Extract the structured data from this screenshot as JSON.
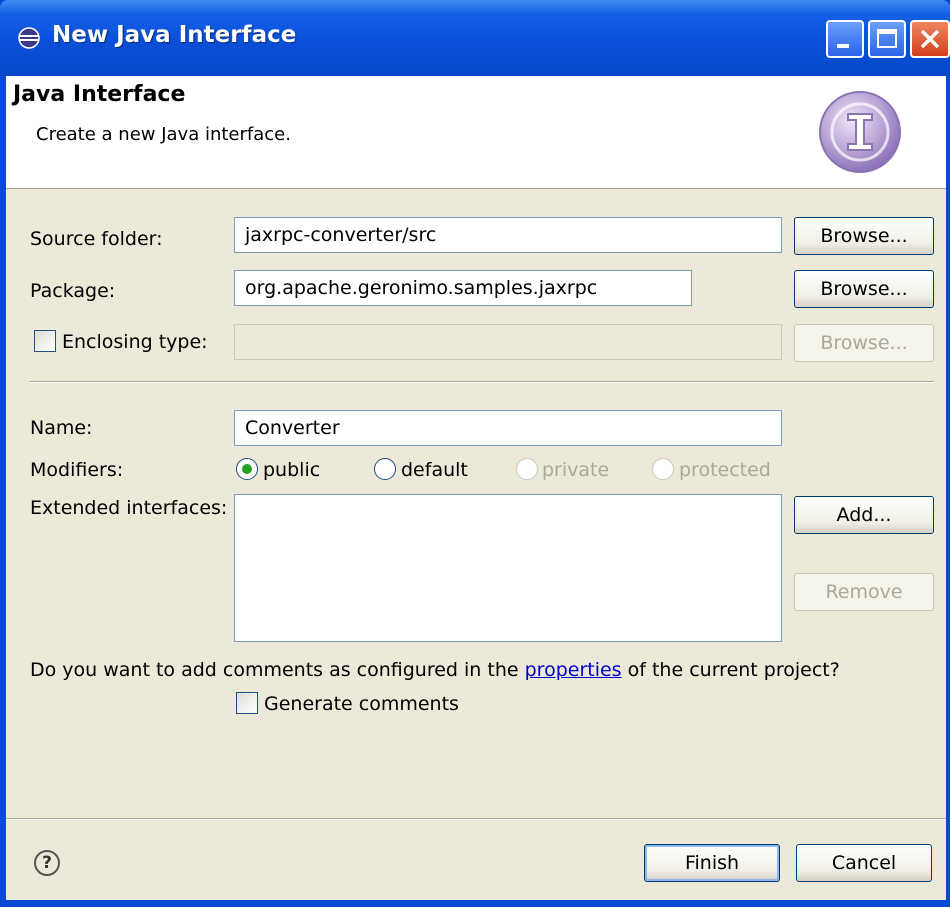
{
  "window": {
    "title": "New Java Interface"
  },
  "header": {
    "title": "Java Interface",
    "description": "Create a new Java interface."
  },
  "form": {
    "source_folder": {
      "label": "Source folder:",
      "value": "jaxrpc-converter/src",
      "browse": "Browse..."
    },
    "package": {
      "label": "Package:",
      "value": "org.apache.geronimo.samples.jaxrpc",
      "browse": "Browse..."
    },
    "enclosing_type": {
      "label": "Enclosing type:",
      "value": "",
      "browse": "Browse...",
      "checked": false
    },
    "name": {
      "label": "Name:",
      "value": "Converter"
    },
    "modifiers": {
      "label": "Modifiers:",
      "options": [
        {
          "label": "public",
          "selected": true,
          "enabled": true
        },
        {
          "label": "default",
          "selected": false,
          "enabled": true
        },
        {
          "label": "private",
          "selected": false,
          "enabled": false
        },
        {
          "label": "protected",
          "selected": false,
          "enabled": false
        }
      ]
    },
    "extended_interfaces": {
      "label": "Extended interfaces:",
      "add": "Add...",
      "remove": "Remove"
    },
    "comments": {
      "question_prefix": "Do you want to add comments as configured in the ",
      "question_link": "properties",
      "question_suffix": " of the current project?",
      "generate_label": "Generate comments",
      "checked": false
    }
  },
  "footer": {
    "help_icon": "help-icon",
    "finish": "Finish",
    "cancel": "Cancel"
  },
  "colors": {
    "titlebar": "#0a4fd9",
    "dialog_bg": "#ece9d8",
    "link": "#0000cc"
  }
}
